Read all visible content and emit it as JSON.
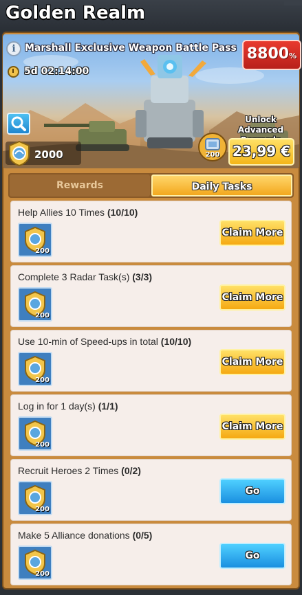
{
  "header": {
    "title": "Golden Realm"
  },
  "banner": {
    "pass_name": "Marshall Exclusive Weapon Battle Pass",
    "discount_value": "8800",
    "discount_pct": "%",
    "timer": "5d 02:14:00",
    "points": "2000",
    "unlock_label": "Unlock Advanced Rewards",
    "crate_count": "200",
    "price": "23,99 €"
  },
  "tabs": [
    {
      "label": "Rewards",
      "active": false
    },
    {
      "label": "Daily Tasks",
      "active": true
    }
  ],
  "tasks": [
    {
      "title": "Help Allies 10 Times",
      "progress": "(10/10)",
      "reward": "200",
      "button": "Claim More",
      "type": "claim"
    },
    {
      "title": "Complete 3 Radar Task(s)",
      "progress": "(3/3)",
      "reward": "200",
      "button": "Claim More",
      "type": "claim"
    },
    {
      "title": "Use 10-min of Speed-ups in total",
      "progress": "(10/10)",
      "reward": "200",
      "button": "Claim More",
      "type": "claim"
    },
    {
      "title": "Log in for 1 day(s)",
      "progress": "(1/1)",
      "reward": "200",
      "button": "Claim More",
      "type": "claim"
    },
    {
      "title": "Recruit Heroes 2 Times",
      "progress": "(0/2)",
      "reward": "200",
      "button": "Go",
      "type": "go"
    },
    {
      "title": "Make 5 Alliance donations",
      "progress": "(0/5)",
      "reward": "200",
      "button": "Go",
      "type": "go"
    }
  ],
  "icons": {
    "info": "info-icon",
    "timer": "clock-icon",
    "search": "magnifier-icon",
    "points": "golden-medal-icon",
    "crate": "supply-crate-icon",
    "close": "close-icon"
  },
  "colors": {
    "claim_button": "#f5b71a",
    "go_button": "#1b9be8",
    "discount": "#d92e22",
    "active_tab": "#f7b32b"
  }
}
